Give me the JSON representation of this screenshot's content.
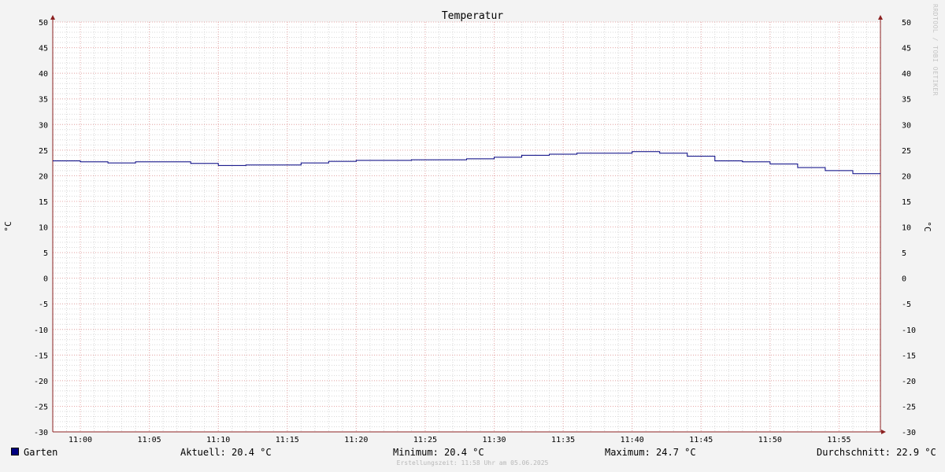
{
  "chart_data": {
    "type": "line",
    "title": "Temperatur",
    "ylabel": "°C",
    "ylabel_right": "°C",
    "ylim": [
      -30,
      50
    ],
    "yticks": [
      50,
      45,
      40,
      35,
      30,
      25,
      20,
      15,
      10,
      5,
      0,
      -5,
      -10,
      -15,
      -20,
      -25,
      -30
    ],
    "xlim": [
      "10:58",
      "11:58"
    ],
    "xticks": [
      "11:00",
      "11:05",
      "11:10",
      "11:15",
      "11:20",
      "11:25",
      "11:30",
      "11:35",
      "11:40",
      "11:45",
      "11:50",
      "11:55"
    ],
    "grid": true,
    "step": true,
    "series": [
      {
        "name": "Garten",
        "color": "#000080",
        "x": [
          "10:58",
          "11:00",
          "11:02",
          "11:04",
          "11:06",
          "11:08",
          "11:10",
          "11:12",
          "11:14",
          "11:16",
          "11:18",
          "11:20",
          "11:22",
          "11:24",
          "11:26",
          "11:28",
          "11:30",
          "11:32",
          "11:34",
          "11:36",
          "11:38",
          "11:40",
          "11:42",
          "11:44",
          "11:46",
          "11:48",
          "11:50",
          "11:52",
          "11:54",
          "11:56"
        ],
        "values": [
          22.9,
          22.7,
          22.5,
          22.7,
          22.7,
          22.4,
          22.0,
          22.1,
          22.1,
          22.5,
          22.8,
          23.0,
          23.0,
          23.1,
          23.1,
          23.3,
          23.6,
          24.0,
          24.2,
          24.4,
          24.4,
          24.7,
          24.4,
          23.8,
          22.9,
          22.7,
          22.3,
          21.6,
          21.0,
          20.4
        ]
      }
    ]
  },
  "legend": {
    "series_label": "Garten",
    "series_color": "#000080",
    "current": "Aktuell: 20.4 °C",
    "minimum": "Minimum: 20.4 °C",
    "maximum": "Maximum: 24.7 °C",
    "average": "Durchschnitt: 22.9 °C"
  },
  "footer": "Erstellungszeit: 11:58 Uhr am 05.06.2025",
  "watermark": "RRDTOOL / TOBI OETIKER",
  "colors": {
    "background": "#f3f3f3",
    "plot_background": "#ffffff",
    "major_grid": "#e8a8a8",
    "minor_grid": "#d8d8d8",
    "axis": "#8b2020"
  }
}
